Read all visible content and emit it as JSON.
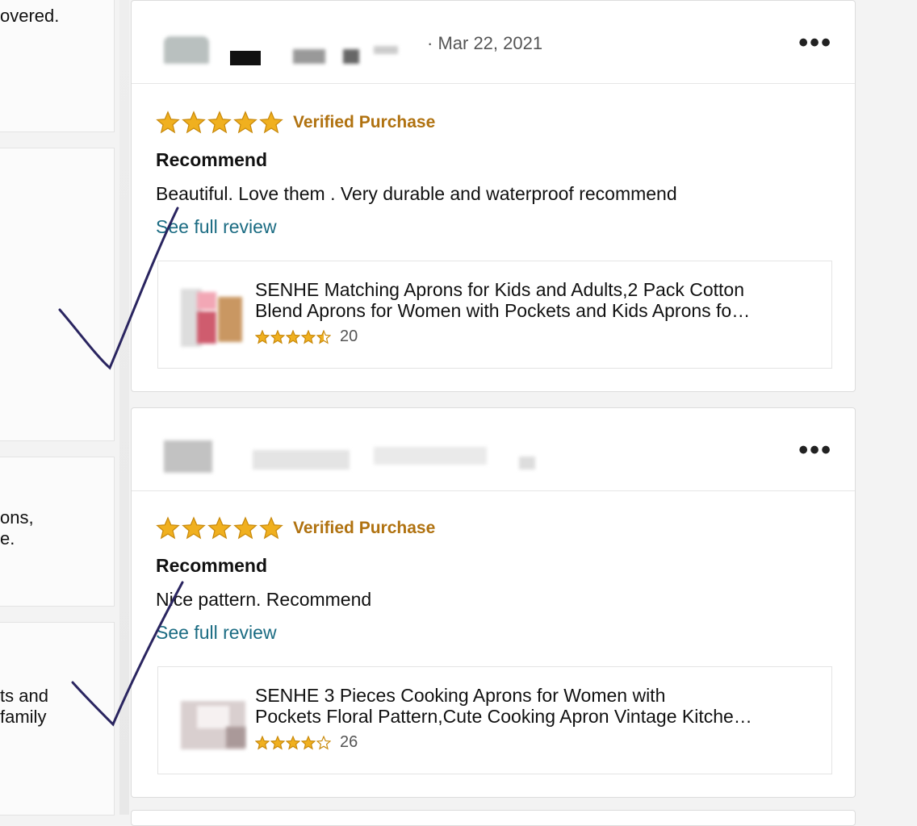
{
  "left_column": {
    "snippets": [
      "overed.",
      "ons,\ne.",
      "ts and\nfamily"
    ]
  },
  "reviews": [
    {
      "date": "· Mar 22, 2021",
      "more_icon": "more-dots-icon",
      "rating": 5,
      "verified": "Verified Purchase",
      "title": "Recommend",
      "body": "Beautiful. Love them . Very durable and waterproof recommend",
      "see_full": "See full review",
      "product": {
        "title_line1": "SENHE Matching Aprons for Kids and Adults,2 Pack Cotton",
        "title_line2": "Blend Aprons for Women with Pockets and Kids Aprons fo…",
        "rating": 4.5,
        "count": "20"
      }
    },
    {
      "date": "",
      "more_icon": "more-dots-icon",
      "rating": 5,
      "verified": "Verified Purchase",
      "title": "Recommend",
      "body": "Nice pattern. Recommend",
      "see_full": "See full review",
      "product": {
        "title_line1": "SENHE 3 Pieces Cooking Aprons for Women with",
        "title_line2": "Pockets Floral Pattern,Cute Cooking Apron Vintage Kitche…",
        "rating": 4,
        "count": "26"
      }
    }
  ],
  "colors": {
    "star": "#f0b01f",
    "star_stroke": "#c98a0c",
    "verified": "#b07210",
    "link": "#1a6b82",
    "checkmark": "#2a2560"
  }
}
